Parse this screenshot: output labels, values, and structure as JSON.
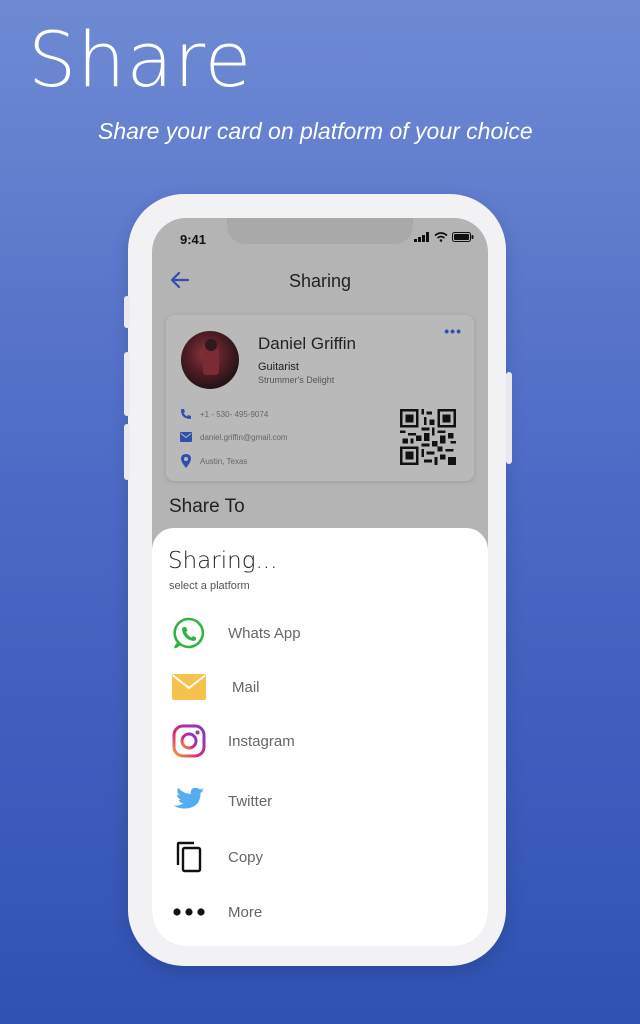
{
  "hero": {
    "title": "Share",
    "subtitle": "Share your card on platform of your choice"
  },
  "status_bar": {
    "time": "9:41"
  },
  "nav": {
    "title": "Sharing"
  },
  "card": {
    "name": "Daniel Griffin",
    "role": "Guitarist",
    "company": "Strummer's Delight",
    "menu": "•••",
    "phone": "+1 - 530- 495-9074",
    "email": "daniel.griffin@gmail.com",
    "location": "Austin, Texas"
  },
  "share_to_label": "Share To",
  "sheet": {
    "title": "Sharing...",
    "subtitle": "select a platform",
    "options": [
      {
        "label": "Whats App",
        "icon": "whatsapp-icon"
      },
      {
        "label": "Mail",
        "icon": "mail-icon"
      },
      {
        "label": "Instagram",
        "icon": "instagram-icon"
      },
      {
        "label": "Twitter",
        "icon": "twitter-icon"
      },
      {
        "label": "Copy",
        "icon": "copy-icon"
      },
      {
        "label": "More",
        "icon": "more-icon"
      }
    ]
  },
  "colors": {
    "background_top": "#6f8ad3",
    "background_bottom": "#2f52b3",
    "accent": "#2f4fb0",
    "whatsapp": "#2fb544",
    "mail": "#f7c14d",
    "twitter": "#55acee"
  }
}
